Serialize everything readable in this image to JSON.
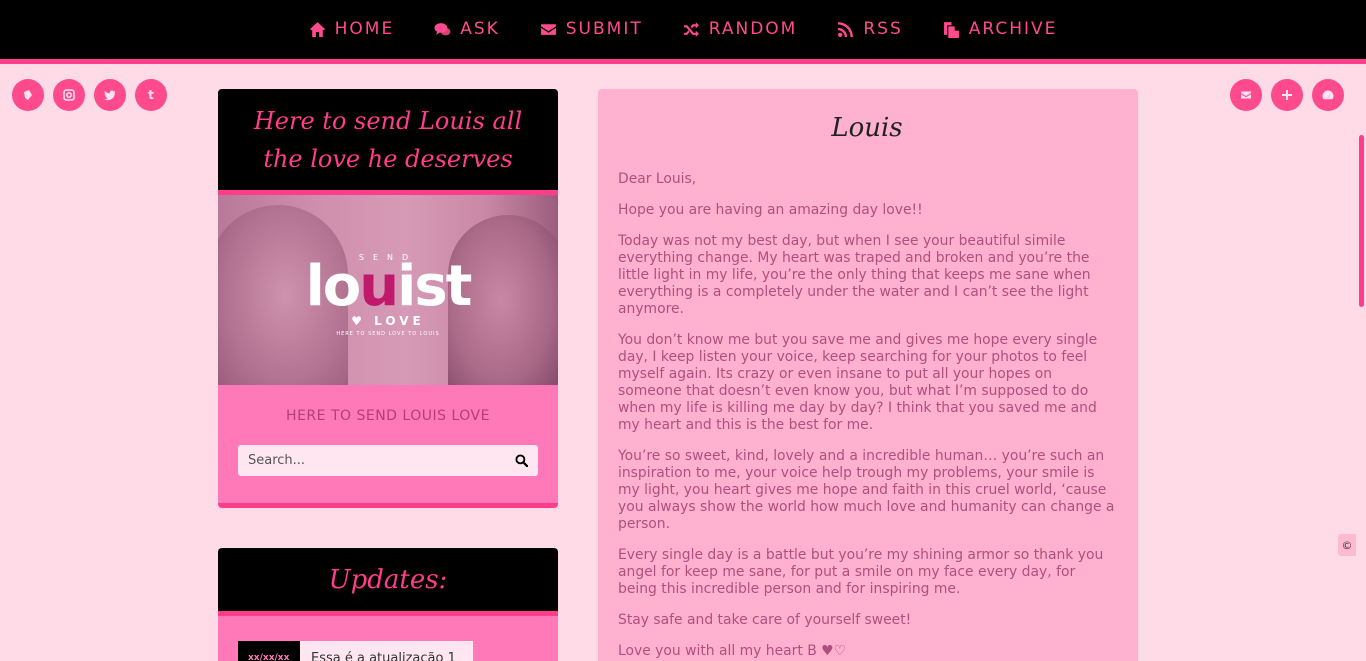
{
  "nav": {
    "items": [
      {
        "label": "HOME",
        "icon": "home-icon"
      },
      {
        "label": "ASK",
        "icon": "chat-bubbles-icon"
      },
      {
        "label": "SUBMIT",
        "icon": "envelope-icon"
      },
      {
        "label": "RANDOM",
        "icon": "shuffle-icon"
      },
      {
        "label": "RSS",
        "icon": "rss-icon"
      },
      {
        "label": "ARCHIVE",
        "icon": "archive-files-icon"
      }
    ]
  },
  "social_left": [
    "bookmark-icon",
    "instagram-icon",
    "twitter-icon",
    "tumblr-icon"
  ],
  "social_right": [
    "envelope-icon",
    "plus-icon",
    "dashboard-icon"
  ],
  "tumblr_letter": "t",
  "sidebar": {
    "title": "Here to send Louis all the love he deserves",
    "banner": {
      "small_word": "SEND",
      "logo_part1": "lo",
      "logo_part2": "u",
      "logo_part3": "ist",
      "love_text": "LOVE",
      "tagline": "HERE TO SEND LOVE TO LOUIS"
    },
    "subtitle": "HERE TO SEND LOUIS LOVE",
    "search_placeholder": "Search..."
  },
  "updates": {
    "title": "Updates:",
    "items": [
      {
        "date": "xx/xx/xx",
        "text": "Essa é a atualização 1"
      }
    ]
  },
  "post": {
    "title": "Louis",
    "paragraphs": [
      "Dear Louis,",
      "Hope you are having an amazing day love!!",
      "Today was not my best day, but when I see your beautiful simile everything change. My heart was traped and broken and you’re the little light in my life, you’re the only thing that keeps me sane when everything is a completely under the water and I can’t see the light anymore.",
      "You don’t know me but you save me and gives me hope every single day, I keep listen your voice, keep searching for your photos to feel myself again. Its crazy or even insane to put all your hopes on someone that doesn’t even know you, but what I’m supposed to do when my life is killing me day by day? I think that you saved me and my heart and this is the best for me.",
      "You’re so sweet, kind, lovely and a incredible human… you’re such an inspiration to me, your voice help trough my problems, your smile is my light, you heart gives me hope and faith in this cruel world, ‘cause you always show the world how much love and humanity can change a person.",
      "Every single day is a battle but you’re my shining armor so thank you angel for keep me sane, for put a smile on my face every day, for being this incredible person and for inspiring me.",
      "Stay safe and take care of yourself sweet!",
      "Love you with all my heart B ♥♡"
    ]
  },
  "copyright_symbol": "©",
  "colors": {
    "accent": "#ff3d8b",
    "nav_bg": "#000000",
    "page_bg": "#ffdbe8",
    "post_bg": "#ffb1cf",
    "sidebar_bg": "#ff79b9"
  }
}
